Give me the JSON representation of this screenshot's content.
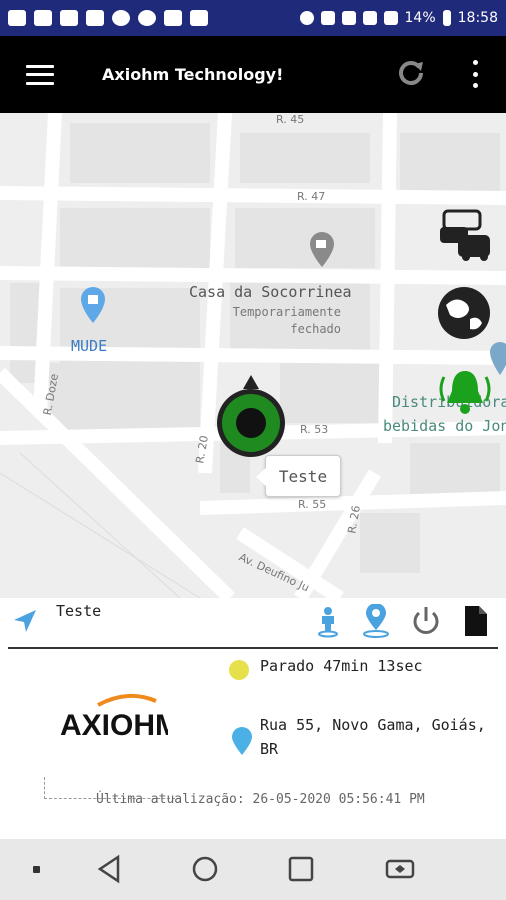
{
  "status_bar": {
    "battery": "14%",
    "time": "18:58"
  },
  "app_bar": {
    "title": "Axiohm Technology!"
  },
  "map": {
    "streets": [
      "R. 45",
      "R. 47",
      "R. Doze",
      "R. 20",
      "R. 53",
      "R. 55",
      "R. 26",
      "Av. Deufino Ju"
    ],
    "poi_name": "Casa da Socorrinea",
    "poi_status": [
      "Temporariamente",
      "fechado"
    ],
    "mude": "MUDE",
    "distributor": [
      "Distribuidora d",
      "bebidas do Jon J"
    ],
    "marker_callout": "Teste"
  },
  "vehicle": {
    "name": "Teste",
    "status": "Parado 47min 13sec",
    "status_color": "#e6e04a",
    "address": "Rua 55, Novo Gama, Goiás, BR",
    "last_update": "Última atualização: 26-05-2020 05:56:41 PM"
  },
  "logo": {
    "text": "AXIOHM"
  },
  "icons": {
    "toolbar": [
      "navigation-arrow-icon",
      "person-pin-icon",
      "location-pin-icon",
      "power-icon",
      "document-icon"
    ],
    "map_fabs": [
      "traffic-icon",
      "globe-icon",
      "alarm-bell-icon"
    ],
    "nav": [
      "recent-dot-icon",
      "back-icon",
      "home-icon",
      "overview-icon",
      "rotate-icon"
    ]
  }
}
